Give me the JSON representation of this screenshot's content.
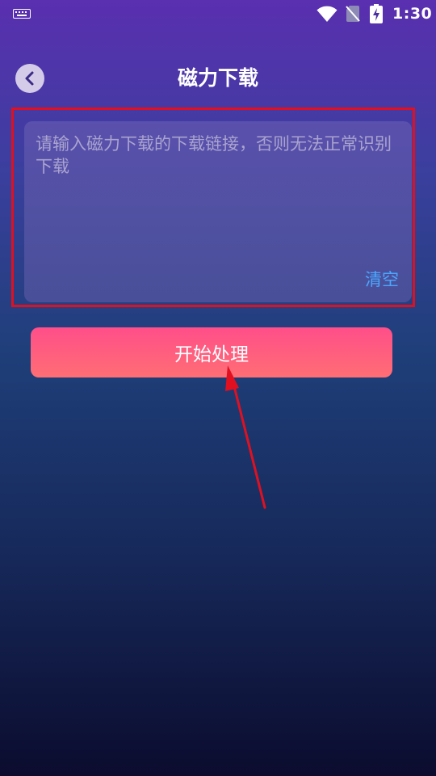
{
  "status_bar": {
    "time": "1:30",
    "icons": [
      "keyboard-icon",
      "wifi-icon",
      "no-sim-icon",
      "battery-charging-icon"
    ]
  },
  "header": {
    "title": "磁力下载",
    "back_icon": "chevron-left-icon"
  },
  "link_input": {
    "value": "",
    "placeholder": "请输入磁力下载的下载链接，否则无法正常识别下载"
  },
  "clear_label": "清空",
  "start_label": "开始处理",
  "colors": {
    "accent_red": "#e01020",
    "clear_blue": "#4aa8ff",
    "button_pink": "#ff5a80",
    "back_button_bg": "#d4cbe8"
  }
}
